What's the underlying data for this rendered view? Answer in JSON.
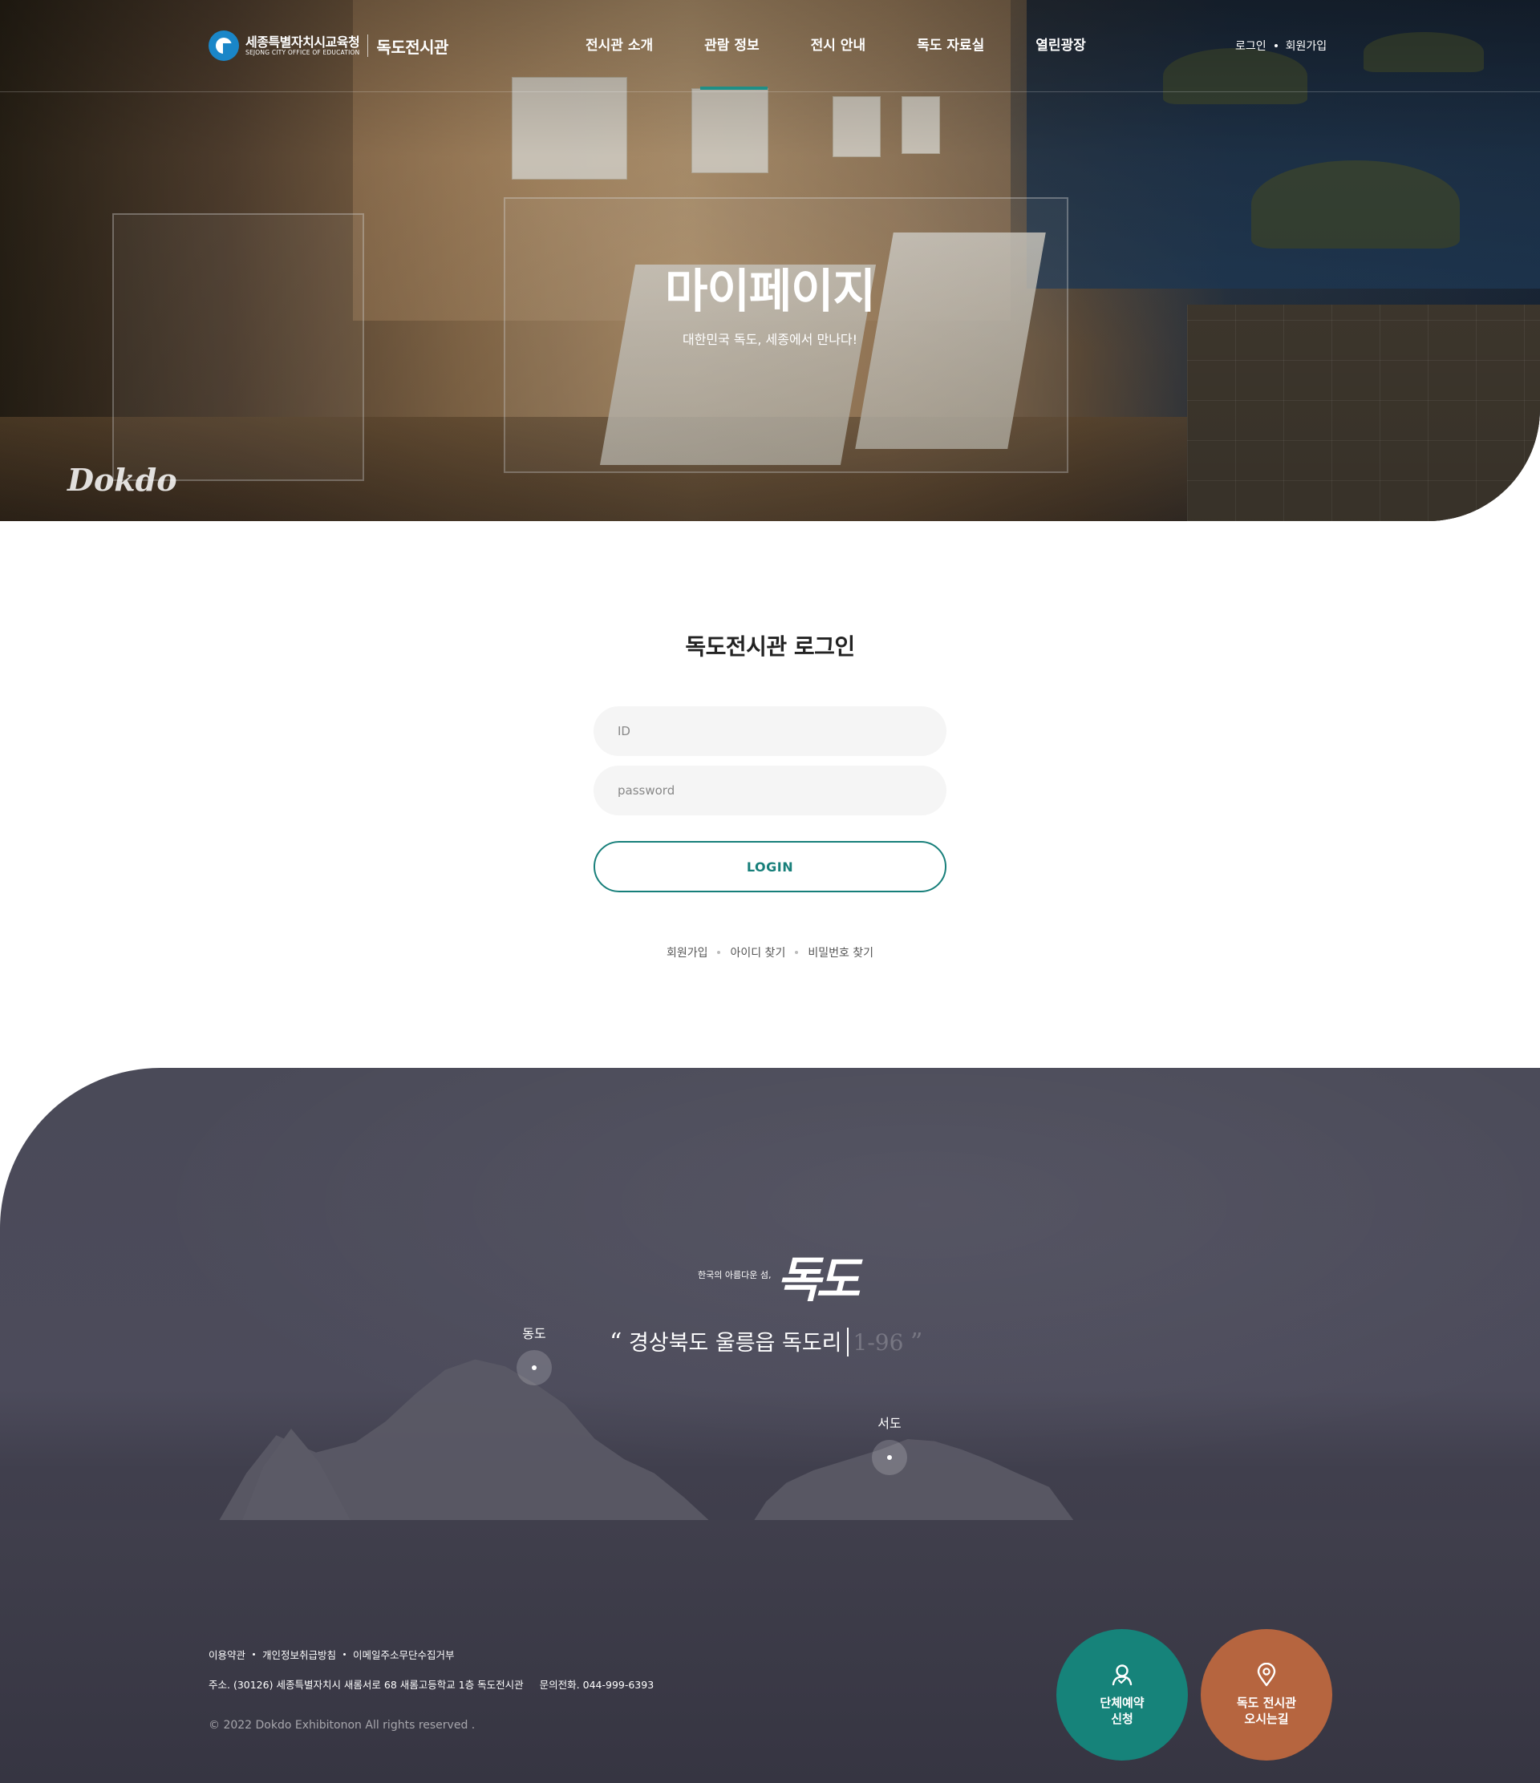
{
  "header": {
    "logo": {
      "org_ko": "세종특별자치시교육청",
      "org_en": "SEJONG CITY OFFICE OF EDUCATION",
      "site_name": "독도전시관"
    },
    "nav": [
      "전시관 소개",
      "관람 정보",
      "전시 안내",
      "독도 자료실",
      "열린광장"
    ],
    "util": {
      "login": "로그인",
      "join": "회원가입"
    }
  },
  "hero": {
    "title": "마이페이지",
    "subtitle": "대한민국 독도, 세종에서 만나다!",
    "watermark": "Dokdo"
  },
  "login": {
    "title": "독도전시관 로그인",
    "id_placeholder": "ID",
    "pw_placeholder": "password",
    "button": "LOGIN",
    "links": [
      "회원가입",
      "아이디 찾기",
      "비밀번호 찾기"
    ]
  },
  "footer": {
    "tagline": "한국의 아름다운 섬,",
    "calligraphy": "독도",
    "address_typed": "경상북도 울릉읍 독도리",
    "address_rest": "1-96",
    "quote_open": "“",
    "quote_close": "”",
    "markers": {
      "east": "동도",
      "west": "서도"
    },
    "links": [
      "이용약관",
      "개인정보취급방침",
      "이메일주소무단수집거부"
    ],
    "address": "주소. (30126) 세종특별자치시 새롬서로 68 새롬고등학교 1층 독도전시관",
    "phone": "문의전화. 044-999-6393",
    "copyright": "© 2022 Dokdo Exhibitonon All rights reserved .",
    "quick_reservation": {
      "line1": "단체예약",
      "line2": "신청",
      "icon": "user-check-icon"
    },
    "quick_directions": {
      "line1": "독도 전시관",
      "line2": "오시는길",
      "icon": "map-pin-icon"
    }
  },
  "colors": {
    "accent": "#177f7a",
    "orange": "#b6653f",
    "footer_bg": "#4a4a58"
  }
}
